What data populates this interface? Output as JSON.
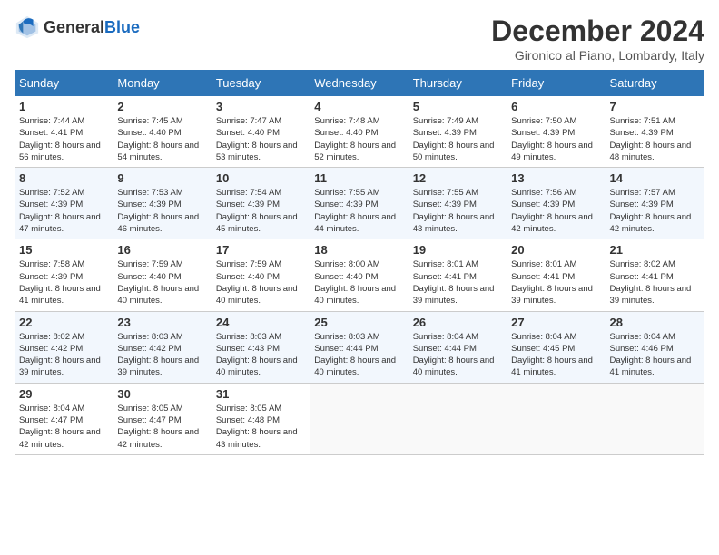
{
  "header": {
    "logo_general": "General",
    "logo_blue": "Blue",
    "title": "December 2024",
    "subtitle": "Gironico al Piano, Lombardy, Italy"
  },
  "days_of_week": [
    "Sunday",
    "Monday",
    "Tuesday",
    "Wednesday",
    "Thursday",
    "Friday",
    "Saturday"
  ],
  "weeks": [
    [
      {
        "day": "1",
        "sunrise": "7:44 AM",
        "sunset": "4:41 PM",
        "daylight": "8 hours and 56 minutes."
      },
      {
        "day": "2",
        "sunrise": "7:45 AM",
        "sunset": "4:40 PM",
        "daylight": "8 hours and 54 minutes."
      },
      {
        "day": "3",
        "sunrise": "7:47 AM",
        "sunset": "4:40 PM",
        "daylight": "8 hours and 53 minutes."
      },
      {
        "day": "4",
        "sunrise": "7:48 AM",
        "sunset": "4:40 PM",
        "daylight": "8 hours and 52 minutes."
      },
      {
        "day": "5",
        "sunrise": "7:49 AM",
        "sunset": "4:39 PM",
        "daylight": "8 hours and 50 minutes."
      },
      {
        "day": "6",
        "sunrise": "7:50 AM",
        "sunset": "4:39 PM",
        "daylight": "8 hours and 49 minutes."
      },
      {
        "day": "7",
        "sunrise": "7:51 AM",
        "sunset": "4:39 PM",
        "daylight": "8 hours and 48 minutes."
      }
    ],
    [
      {
        "day": "8",
        "sunrise": "7:52 AM",
        "sunset": "4:39 PM",
        "daylight": "8 hours and 47 minutes."
      },
      {
        "day": "9",
        "sunrise": "7:53 AM",
        "sunset": "4:39 PM",
        "daylight": "8 hours and 46 minutes."
      },
      {
        "day": "10",
        "sunrise": "7:54 AM",
        "sunset": "4:39 PM",
        "daylight": "8 hours and 45 minutes."
      },
      {
        "day": "11",
        "sunrise": "7:55 AM",
        "sunset": "4:39 PM",
        "daylight": "8 hours and 44 minutes."
      },
      {
        "day": "12",
        "sunrise": "7:55 AM",
        "sunset": "4:39 PM",
        "daylight": "8 hours and 43 minutes."
      },
      {
        "day": "13",
        "sunrise": "7:56 AM",
        "sunset": "4:39 PM",
        "daylight": "8 hours and 42 minutes."
      },
      {
        "day": "14",
        "sunrise": "7:57 AM",
        "sunset": "4:39 PM",
        "daylight": "8 hours and 42 minutes."
      }
    ],
    [
      {
        "day": "15",
        "sunrise": "7:58 AM",
        "sunset": "4:39 PM",
        "daylight": "8 hours and 41 minutes."
      },
      {
        "day": "16",
        "sunrise": "7:59 AM",
        "sunset": "4:40 PM",
        "daylight": "8 hours and 40 minutes."
      },
      {
        "day": "17",
        "sunrise": "7:59 AM",
        "sunset": "4:40 PM",
        "daylight": "8 hours and 40 minutes."
      },
      {
        "day": "18",
        "sunrise": "8:00 AM",
        "sunset": "4:40 PM",
        "daylight": "8 hours and 40 minutes."
      },
      {
        "day": "19",
        "sunrise": "8:01 AM",
        "sunset": "4:41 PM",
        "daylight": "8 hours and 39 minutes."
      },
      {
        "day": "20",
        "sunrise": "8:01 AM",
        "sunset": "4:41 PM",
        "daylight": "8 hours and 39 minutes."
      },
      {
        "day": "21",
        "sunrise": "8:02 AM",
        "sunset": "4:41 PM",
        "daylight": "8 hours and 39 minutes."
      }
    ],
    [
      {
        "day": "22",
        "sunrise": "8:02 AM",
        "sunset": "4:42 PM",
        "daylight": "8 hours and 39 minutes."
      },
      {
        "day": "23",
        "sunrise": "8:03 AM",
        "sunset": "4:42 PM",
        "daylight": "8 hours and 39 minutes."
      },
      {
        "day": "24",
        "sunrise": "8:03 AM",
        "sunset": "4:43 PM",
        "daylight": "8 hours and 40 minutes."
      },
      {
        "day": "25",
        "sunrise": "8:03 AM",
        "sunset": "4:44 PM",
        "daylight": "8 hours and 40 minutes."
      },
      {
        "day": "26",
        "sunrise": "8:04 AM",
        "sunset": "4:44 PM",
        "daylight": "8 hours and 40 minutes."
      },
      {
        "day": "27",
        "sunrise": "8:04 AM",
        "sunset": "4:45 PM",
        "daylight": "8 hours and 41 minutes."
      },
      {
        "day": "28",
        "sunrise": "8:04 AM",
        "sunset": "4:46 PM",
        "daylight": "8 hours and 41 minutes."
      }
    ],
    [
      {
        "day": "29",
        "sunrise": "8:04 AM",
        "sunset": "4:47 PM",
        "daylight": "8 hours and 42 minutes."
      },
      {
        "day": "30",
        "sunrise": "8:05 AM",
        "sunset": "4:47 PM",
        "daylight": "8 hours and 42 minutes."
      },
      {
        "day": "31",
        "sunrise": "8:05 AM",
        "sunset": "4:48 PM",
        "daylight": "8 hours and 43 minutes."
      },
      null,
      null,
      null,
      null
    ]
  ]
}
